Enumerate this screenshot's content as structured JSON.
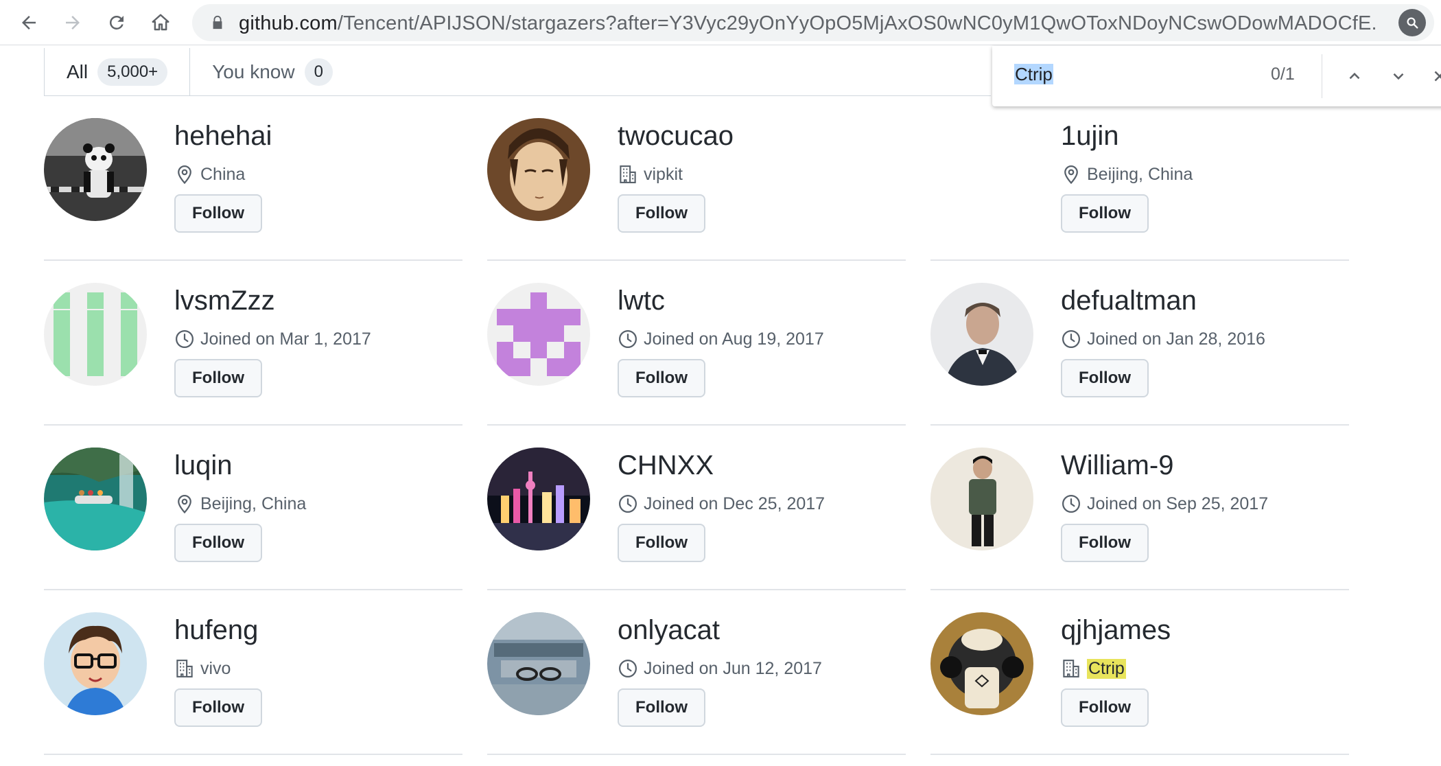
{
  "browser": {
    "url_host": "github.com",
    "url_path": "/Tencent/APIJSON/stargazers?after=Y3Vyc29yOnYyOpO5MjAxOS0wNC0yM1QwOToxNDoyNCswODowMADOCfE..."
  },
  "tabs": [
    {
      "label": "All",
      "count": "5,000+"
    },
    {
      "label": "You know",
      "count": "0"
    }
  ],
  "find": {
    "query": "Ctrip",
    "count": "0/1"
  },
  "follow_label": "Follow",
  "users": [
    {
      "name": "hehehai",
      "meta_icon": "location-icon",
      "meta": "China"
    },
    {
      "name": "twocucao",
      "meta_icon": "organization-icon",
      "meta": "vipkit"
    },
    {
      "name": "1ujin",
      "meta_icon": "location-icon",
      "meta": "Beijing, China"
    },
    {
      "name": "lvsmZzz",
      "meta_icon": "clock-icon",
      "meta": "Joined on Mar 1, 2017"
    },
    {
      "name": "lwtc",
      "meta_icon": "clock-icon",
      "meta": "Joined on Aug 19, 2017"
    },
    {
      "name": "defualtman",
      "meta_icon": "clock-icon",
      "meta": "Joined on Jan 28, 2016"
    },
    {
      "name": "luqin",
      "meta_icon": "location-icon",
      "meta": "Beijing, China"
    },
    {
      "name": "CHNXX",
      "meta_icon": "clock-icon",
      "meta": "Joined on Dec 25, 2017"
    },
    {
      "name": "William-9",
      "meta_icon": "clock-icon",
      "meta": "Joined on Sep 25, 2017"
    },
    {
      "name": "hufeng",
      "meta_icon": "organization-icon",
      "meta": "vivo"
    },
    {
      "name": "onlyacat",
      "meta_icon": "clock-icon",
      "meta": "Joined on Jun 12, 2017"
    },
    {
      "name": "qjhjames",
      "meta_icon": "organization-icon",
      "meta": "Ctrip",
      "highlighted": true
    }
  ],
  "colors": {
    "find_match_highlight": "#e8e45c",
    "find_query_selection": "#b3d7ff",
    "border": "#d0d7de"
  }
}
